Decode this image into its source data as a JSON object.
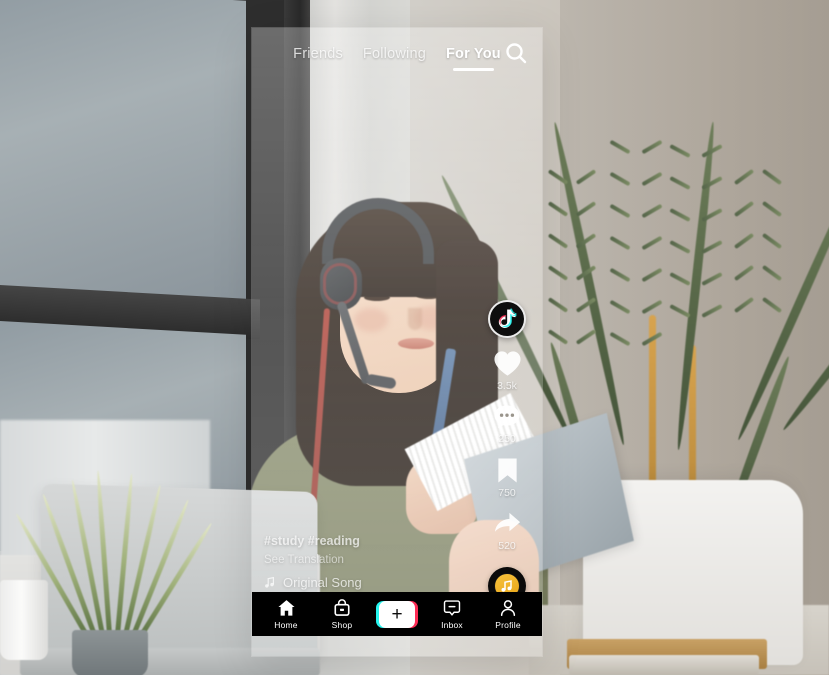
{
  "app": {
    "name": "TikTok",
    "screen": "For You feed"
  },
  "top_nav": {
    "tabs": [
      {
        "label": "Friends",
        "active": false
      },
      {
        "label": "Following",
        "active": false
      },
      {
        "label": "For You",
        "active": true
      }
    ],
    "search_icon": "search-icon"
  },
  "action_rail": {
    "avatar_icon": "tiktok-note-logo",
    "items": [
      {
        "icon": "heart-icon",
        "count": "3.5k"
      },
      {
        "icon": "comment-icon",
        "count": "250"
      },
      {
        "icon": "bookmark-icon",
        "count": "750"
      },
      {
        "icon": "share-arrow-icon",
        "count": "520"
      }
    ],
    "music_disc_icon": "music-note-disc-icon"
  },
  "caption": {
    "hashtags": "#study #reading",
    "translate": "See Translation",
    "music_note_icon": "music-note-icon",
    "song": "Original Song"
  },
  "bottom_nav": {
    "items": [
      {
        "label": "Home",
        "icon": "home-icon"
      },
      {
        "label": "Shop",
        "icon": "shopping-bag-icon"
      },
      {
        "label": "Inbox",
        "icon": "inbox-message-icon"
      },
      {
        "label": "Profile",
        "icon": "person-icon"
      }
    ],
    "create_label": "+",
    "create_icon": "create-plus-button"
  },
  "colors": {
    "tiktok_cyan": "#25f4ee",
    "tiktok_red": "#fe2c55",
    "nav_background": "#000000",
    "disc_accent": "#f0b429",
    "text_white": "#ffffff"
  },
  "background_scene": {
    "description": "Woman with headset holding a pen, desk with laptop, plants, books and a white chair"
  }
}
